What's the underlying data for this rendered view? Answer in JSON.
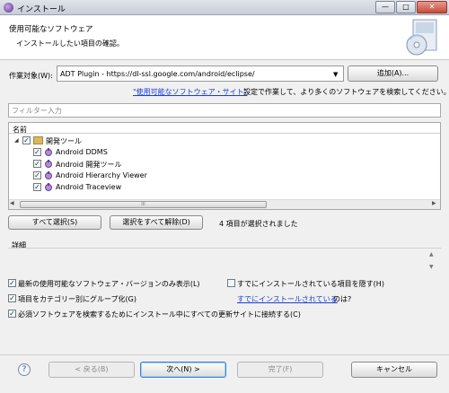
{
  "window": {
    "title": "インストール",
    "min_glyph": "—",
    "max_glyph": "□",
    "close_glyph": "✕"
  },
  "header": {
    "title": "使用可能なソフトウェア",
    "description": "インストールしたい項目の確認。"
  },
  "work_with": {
    "label": "作業対象(W):",
    "value": "ADT Plugin - https://dl-ssl.google.com/android/eclipse/",
    "add_button": "追加(A)..."
  },
  "hint": {
    "link": "\"使用可能なソフトウェア・サイト\"",
    "rest": "設定で作業して、より多くのソフトウェアを検索してください。"
  },
  "filter": {
    "placeholder": "フィルター入力"
  },
  "tree": {
    "column": "名前",
    "expander": "◢",
    "group": {
      "label": "開発ツール",
      "checked": "✓"
    },
    "items": [
      {
        "label": "Android DDMS",
        "checked": "✓"
      },
      {
        "label": "Android 開発ツール",
        "checked": "✓"
      },
      {
        "label": "Android Hierarchy Viewer",
        "checked": "✓"
      },
      {
        "label": "Android Traceview",
        "checked": "✓"
      }
    ],
    "scroll_left": "◀",
    "scroll_right": "▶",
    "thumb_grip": "III"
  },
  "buttons": {
    "select_all": "すべて選択(S)",
    "deselect_all": "選択をすべて解除(D)",
    "selected_count": "4 項目が選択されました"
  },
  "details": {
    "label": "詳細",
    "scroll_up": "▲",
    "scroll_down": "▼"
  },
  "options": {
    "latest_only": {
      "label": "最新の使用可能なソフトウェア・バージョンのみ表示(L)",
      "checked": "✓"
    },
    "hide_installed": {
      "label": "すでにインストールされている項目を隠す(H)",
      "checked": ""
    },
    "group_by_category": {
      "label": "項目をカテゴリー別にグループ化(G)",
      "checked": "✓"
    },
    "already_installed_link": "すでにインストールされている",
    "already_installed_suffix": "のは?",
    "contact_sites": {
      "label": "必須ソフトウェアを検索するためにインストール中にすべての更新サイトに接続する(C)",
      "checked": "✓"
    }
  },
  "footer": {
    "help": "?",
    "back": "< 戻る(B)",
    "next": "次へ(N) >",
    "finish": "完了(F)",
    "cancel": "キャンセル"
  },
  "colors": {
    "link": "#1a3fd6",
    "accent": "#3f7fc8",
    "plugin_icon": "#b48cd6",
    "folder_icon": "#d8b85a"
  }
}
